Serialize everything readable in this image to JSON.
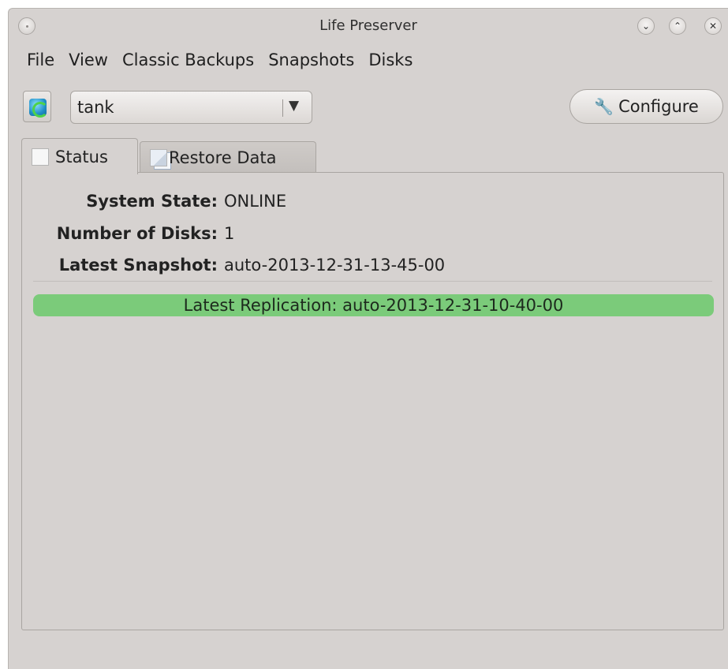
{
  "window": {
    "title": "Life Preserver"
  },
  "menu": [
    "File",
    "View",
    "Classic Backups",
    "Snapshots",
    "Disks"
  ],
  "toolbar": {
    "pool_value": "tank",
    "configure_label": "Configure"
  },
  "tabs": [
    {
      "label": "Status",
      "active": true
    },
    {
      "label": "Restore Data",
      "active": false
    }
  ],
  "status": {
    "system_state_label": "System State:",
    "system_state_value": "ONLINE",
    "num_disks_label": "Number of Disks:",
    "num_disks_value": "1",
    "latest_snapshot_label": "Latest Snapshot:",
    "latest_snapshot_value": "auto-2013-12-31-13-45-00",
    "replication_text": "Latest Replication: auto-2013-12-31-10-40-00",
    "replication_color": "#7bcb7a"
  }
}
